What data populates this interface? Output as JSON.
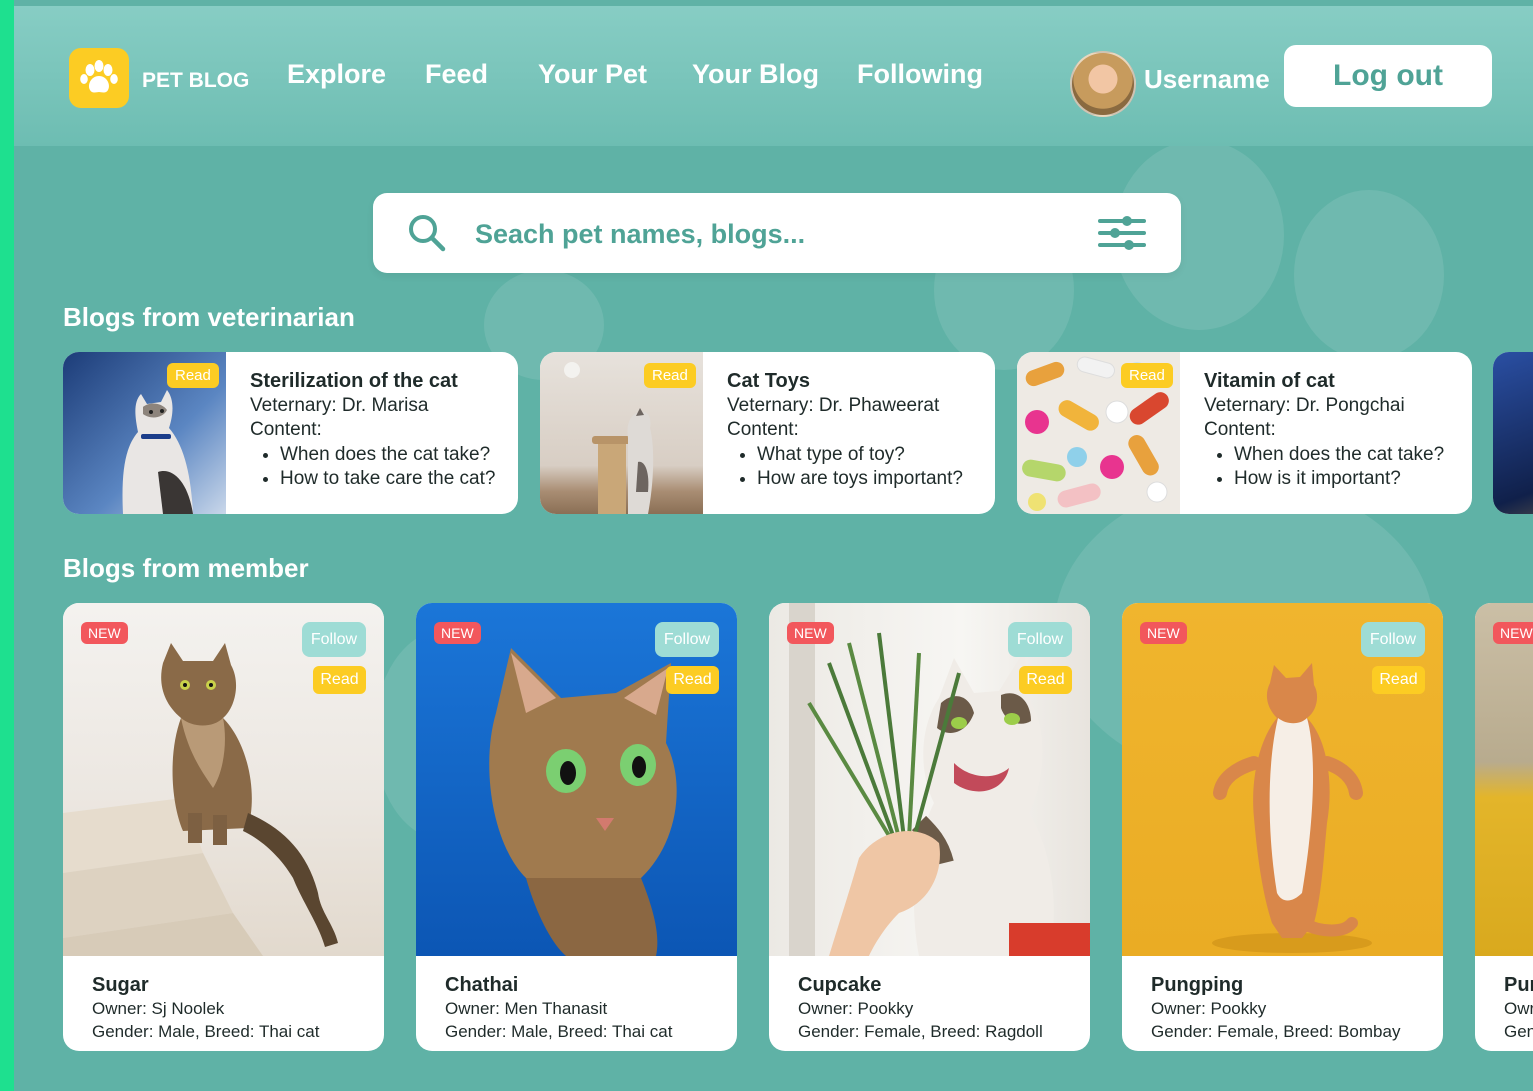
{
  "brand": {
    "name": "PET BLOG",
    "logo_icon": "paw-icon"
  },
  "nav": [
    {
      "label": "Explore"
    },
    {
      "label": "Feed"
    },
    {
      "label": "Your Pet"
    },
    {
      "label": "Your Blog"
    },
    {
      "label": "Following"
    }
  ],
  "user": {
    "name": "Username",
    "logout_label": "Log out"
  },
  "search": {
    "placeholder": "Seach pet names, blogs...",
    "icon": "search-icon",
    "filter_icon": "filter-sliders-icon"
  },
  "sections": {
    "vet_title": "Blogs from veterinarian",
    "member_title": "Blogs from member"
  },
  "vet_blogs": [
    {
      "title": "Sterilization of the cat",
      "vet": "Veternary: Dr. Marisa",
      "content_label": "Content:",
      "points": [
        "When does the cat take?",
        "How to take care the cat?"
      ],
      "read_label": "Read"
    },
    {
      "title": "Cat Toys",
      "vet": "Veternary: Dr. Phaweerat",
      "content_label": "Content:",
      "points": [
        "What type of toy?",
        "How are toys important?"
      ],
      "read_label": "Read"
    },
    {
      "title": "Vitamin of cat",
      "vet": "Veternary: Dr. Pongchai",
      "content_label": "Content:",
      "points": [
        "When does the cat take?",
        "How is it important?"
      ],
      "read_label": "Read"
    }
  ],
  "member_blogs": [
    {
      "name": "Sugar",
      "owner": "Owner: Sj Noolek",
      "details": "Gender: Male, Breed: Thai cat",
      "new_label": "NEW",
      "follow_label": "Follow",
      "read_label": "Read"
    },
    {
      "name": "Chathai",
      "owner": "Owner: Men Thanasit",
      "details": "Gender: Male, Breed: Thai cat",
      "new_label": "NEW",
      "follow_label": "Follow",
      "read_label": "Read"
    },
    {
      "name": "Cupcake",
      "owner": "Owner: Pookky",
      "details": "Gender: Female, Breed: Ragdoll",
      "new_label": "NEW",
      "follow_label": "Follow",
      "read_label": "Read"
    },
    {
      "name": "Pungping",
      "owner": "Owner: Pookky",
      "details": "Gender: Female, Breed: Bombay",
      "new_label": "NEW",
      "follow_label": "Follow",
      "read_label": "Read"
    },
    {
      "name": "Pur",
      "owner": "Owr",
      "details": "Gen",
      "new_label": "NEW"
    }
  ],
  "colors": {
    "teal_bg": "#5fb2a6",
    "accent_yellow": "#fccc23",
    "new_red": "#f2575c",
    "follow_teal": "#9edcd5",
    "text_teal": "#4fa396"
  }
}
